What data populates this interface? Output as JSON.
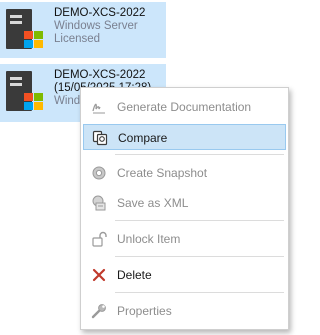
{
  "items": [
    {
      "name": "DEMO-XCS-2022",
      "line2": "Windows Server",
      "line3": "Licensed"
    },
    {
      "name": "DEMO-XCS-2022",
      "line2": "(15/05/2025 17:28)",
      "line3": "Windo"
    }
  ],
  "menu": {
    "generate_documentation": "Generate Documentation",
    "compare": "Compare",
    "create_snapshot": "Create Snapshot",
    "save_as_xml": "Save as XML",
    "unlock_item": "Unlock Item",
    "delete": "Delete",
    "properties": "Properties"
  },
  "icons": {
    "generate_documentation": "signature-icon",
    "compare": "compare-icon",
    "create_snapshot": "snapshot-icon",
    "save_as_xml": "save-xml-icon",
    "unlock_item": "unlock-icon",
    "delete": "delete-x-icon",
    "properties": "wrench-icon"
  },
  "colors": {
    "selection": "#cce6fb",
    "menu_highlight": "#cce4f7",
    "delete_red": "#c0392b"
  }
}
